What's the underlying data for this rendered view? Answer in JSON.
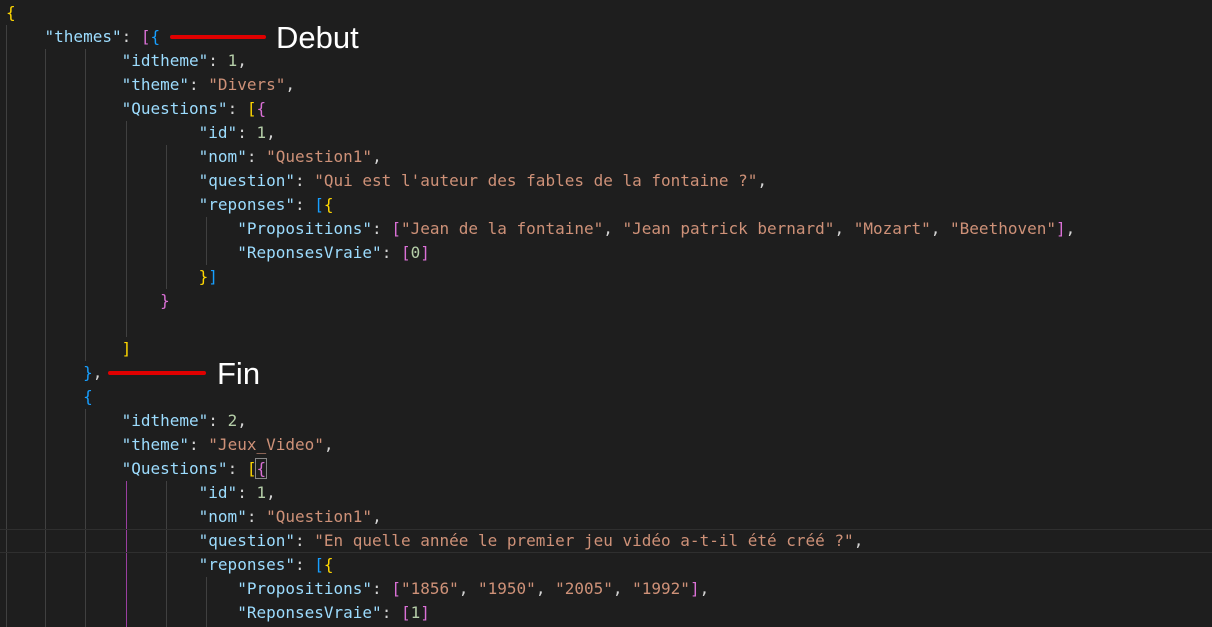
{
  "editor": {
    "language": "json",
    "colors": {
      "background": "#1e1e1e",
      "key": "#9cdcfe",
      "string": "#ce9178",
      "number": "#b5cea8",
      "bracket_level_1": "#ffd700",
      "bracket_level_2": "#da70d6",
      "bracket_level_3": "#179fff",
      "annotation_marker": "#e00000"
    },
    "lines": [
      {
        "tokens": [
          [
            "b1",
            "{"
          ]
        ]
      },
      {
        "tokens": [
          [
            "p",
            "    "
          ],
          [
            "k",
            "\"themes\""
          ],
          [
            "p",
            ": "
          ],
          [
            "b2",
            "["
          ],
          [
            "b3",
            "{"
          ]
        ]
      },
      {
        "tokens": [
          [
            "p",
            "            "
          ],
          [
            "k",
            "\"idtheme\""
          ],
          [
            "p",
            ": "
          ],
          [
            "n",
            "1"
          ],
          [
            "p",
            ","
          ]
        ]
      },
      {
        "tokens": [
          [
            "p",
            "            "
          ],
          [
            "k",
            "\"theme\""
          ],
          [
            "p",
            ": "
          ],
          [
            "s",
            "\"Divers\""
          ],
          [
            "p",
            ","
          ]
        ]
      },
      {
        "tokens": [
          [
            "p",
            "            "
          ],
          [
            "k",
            "\"Questions\""
          ],
          [
            "p",
            ": "
          ],
          [
            "b1",
            "["
          ],
          [
            "b2",
            "{"
          ]
        ]
      },
      {
        "tokens": [
          [
            "p",
            "                    "
          ],
          [
            "k",
            "\"id\""
          ],
          [
            "p",
            ": "
          ],
          [
            "n",
            "1"
          ],
          [
            "p",
            ","
          ]
        ]
      },
      {
        "tokens": [
          [
            "p",
            "                    "
          ],
          [
            "k",
            "\"nom\""
          ],
          [
            "p",
            ": "
          ],
          [
            "s",
            "\"Question1\""
          ],
          [
            "p",
            ","
          ]
        ]
      },
      {
        "tokens": [
          [
            "p",
            "                    "
          ],
          [
            "k",
            "\"question\""
          ],
          [
            "p",
            ": "
          ],
          [
            "s",
            "\"Qui est l'auteur des fables de la fontaine ?\""
          ],
          [
            "p",
            ","
          ]
        ]
      },
      {
        "tokens": [
          [
            "p",
            "                    "
          ],
          [
            "k",
            "\"reponses\""
          ],
          [
            "p",
            ": "
          ],
          [
            "b3",
            "["
          ],
          [
            "b1",
            "{"
          ]
        ]
      },
      {
        "tokens": [
          [
            "p",
            "                        "
          ],
          [
            "k",
            "\"Propositions\""
          ],
          [
            "p",
            ": "
          ],
          [
            "b2",
            "["
          ],
          [
            "s",
            "\"Jean de la fontaine\""
          ],
          [
            "p",
            ", "
          ],
          [
            "s",
            "\"Jean patrick bernard\""
          ],
          [
            "p",
            ", "
          ],
          [
            "s",
            "\"Mozart\""
          ],
          [
            "p",
            ", "
          ],
          [
            "s",
            "\"Beethoven\""
          ],
          [
            "b2",
            "]"
          ],
          [
            "p",
            ","
          ]
        ]
      },
      {
        "tokens": [
          [
            "p",
            "                        "
          ],
          [
            "k",
            "\"ReponsesVraie\""
          ],
          [
            "p",
            ": "
          ],
          [
            "b2",
            "["
          ],
          [
            "n",
            "0"
          ],
          [
            "b2",
            "]"
          ]
        ]
      },
      {
        "tokens": [
          [
            "p",
            "                    "
          ],
          [
            "b1",
            "}"
          ],
          [
            "b3",
            "]"
          ]
        ]
      },
      {
        "tokens": [
          [
            "p",
            "                "
          ],
          [
            "b2",
            "}"
          ]
        ]
      },
      {
        "tokens": []
      },
      {
        "tokens": [
          [
            "p",
            "            "
          ],
          [
            "b1",
            "]"
          ]
        ]
      },
      {
        "tokens": [
          [
            "p",
            "        "
          ],
          [
            "b3",
            "}"
          ],
          [
            "p",
            ","
          ]
        ]
      },
      {
        "tokens": [
          [
            "p",
            "        "
          ],
          [
            "b3",
            "{"
          ]
        ]
      },
      {
        "tokens": [
          [
            "p",
            "            "
          ],
          [
            "k",
            "\"idtheme\""
          ],
          [
            "p",
            ": "
          ],
          [
            "n",
            "2"
          ],
          [
            "p",
            ","
          ]
        ]
      },
      {
        "tokens": [
          [
            "p",
            "            "
          ],
          [
            "k",
            "\"theme\""
          ],
          [
            "p",
            ": "
          ],
          [
            "s",
            "\"Jeux_Video\""
          ],
          [
            "p",
            ","
          ]
        ]
      },
      {
        "tokens": [
          [
            "p",
            "            "
          ],
          [
            "k",
            "\"Questions\""
          ],
          [
            "p",
            ": "
          ],
          [
            "b1",
            "["
          ],
          [
            "b2m",
            "{"
          ]
        ]
      },
      {
        "tokens": [
          [
            "p",
            "                    "
          ],
          [
            "k",
            "\"id\""
          ],
          [
            "p",
            ": "
          ],
          [
            "n",
            "1"
          ],
          [
            "p",
            ","
          ]
        ]
      },
      {
        "tokens": [
          [
            "p",
            "                    "
          ],
          [
            "k",
            "\"nom\""
          ],
          [
            "p",
            ": "
          ],
          [
            "s",
            "\"Question1\""
          ],
          [
            "p",
            ","
          ]
        ]
      },
      {
        "tokens": [
          [
            "p",
            "                    "
          ],
          [
            "k",
            "\"question\""
          ],
          [
            "p",
            ": "
          ],
          [
            "s",
            "\"En quelle année le premier jeu vidéo a-t-il été créé ?\""
          ],
          [
            "p",
            ","
          ]
        ]
      },
      {
        "tokens": [
          [
            "p",
            "                    "
          ],
          [
            "k",
            "\"reponses\""
          ],
          [
            "p",
            ": "
          ],
          [
            "b3",
            "["
          ],
          [
            "b1",
            "{"
          ]
        ]
      },
      {
        "tokens": [
          [
            "p",
            "                        "
          ],
          [
            "k",
            "\"Propositions\""
          ],
          [
            "p",
            ": "
          ],
          [
            "b2",
            "["
          ],
          [
            "s",
            "\"1856\""
          ],
          [
            "p",
            ", "
          ],
          [
            "s",
            "\"1950\""
          ],
          [
            "p",
            ", "
          ],
          [
            "s",
            "\"2005\""
          ],
          [
            "p",
            ", "
          ],
          [
            "s",
            "\"1992\""
          ],
          [
            "b2",
            "]"
          ],
          [
            "p",
            ","
          ]
        ]
      },
      {
        "tokens": [
          [
            "p",
            "                        "
          ],
          [
            "k",
            "\"ReponsesVraie\""
          ],
          [
            "p",
            ": "
          ],
          [
            "b2",
            "["
          ],
          [
            "n",
            "1"
          ],
          [
            "b2",
            "]"
          ]
        ]
      }
    ]
  },
  "annotations": {
    "start_label": "Debut",
    "end_label": "Fin"
  }
}
